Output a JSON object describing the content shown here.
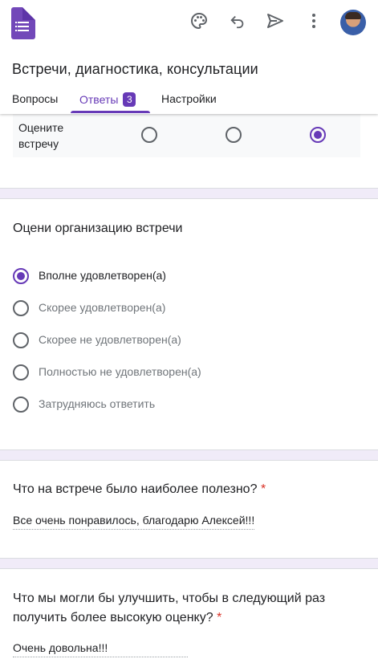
{
  "header": {
    "icons": [
      "forms-logo-icon",
      "palette-icon",
      "undo-icon",
      "send-icon",
      "more-vert-icon",
      "avatar"
    ],
    "title": "Встречи, диагностика, консультации"
  },
  "tabs": [
    {
      "label": "Вопросы",
      "active": false
    },
    {
      "label": "Ответы",
      "active": true,
      "badge": "3"
    },
    {
      "label": "Настройки",
      "active": false
    }
  ],
  "grid_question": {
    "row_label": "Оцените встречу",
    "selected_column": 3,
    "columns": 3
  },
  "question1": {
    "title": "Оцени организацию встречи",
    "options": [
      {
        "label": "Вполне удовлетворен(а)",
        "selected": true
      },
      {
        "label": "Скорее удовлетворен(а)",
        "selected": false
      },
      {
        "label": "Скорее не удовлетворен(а)",
        "selected": false
      },
      {
        "label": "Полностью не удовлетворен(а)",
        "selected": false
      },
      {
        "label": "Затрудняюсь ответить",
        "selected": false
      }
    ]
  },
  "question2": {
    "title": "Что на встрече было наиболее полезно?",
    "required_mark": "*",
    "answer": "Все очень понравилось, благодарю Алексей!!!"
  },
  "question3": {
    "title_line1": "Что мы могли бы улучшить, чтобы в следующий раз",
    "title_line2": "получить более высокую оценку?",
    "required_mark": "*",
    "answer": "Очень довольна!!!"
  },
  "colors": {
    "accent": "#673ab7",
    "background": "#f0ebf8",
    "required": "#d93025"
  }
}
